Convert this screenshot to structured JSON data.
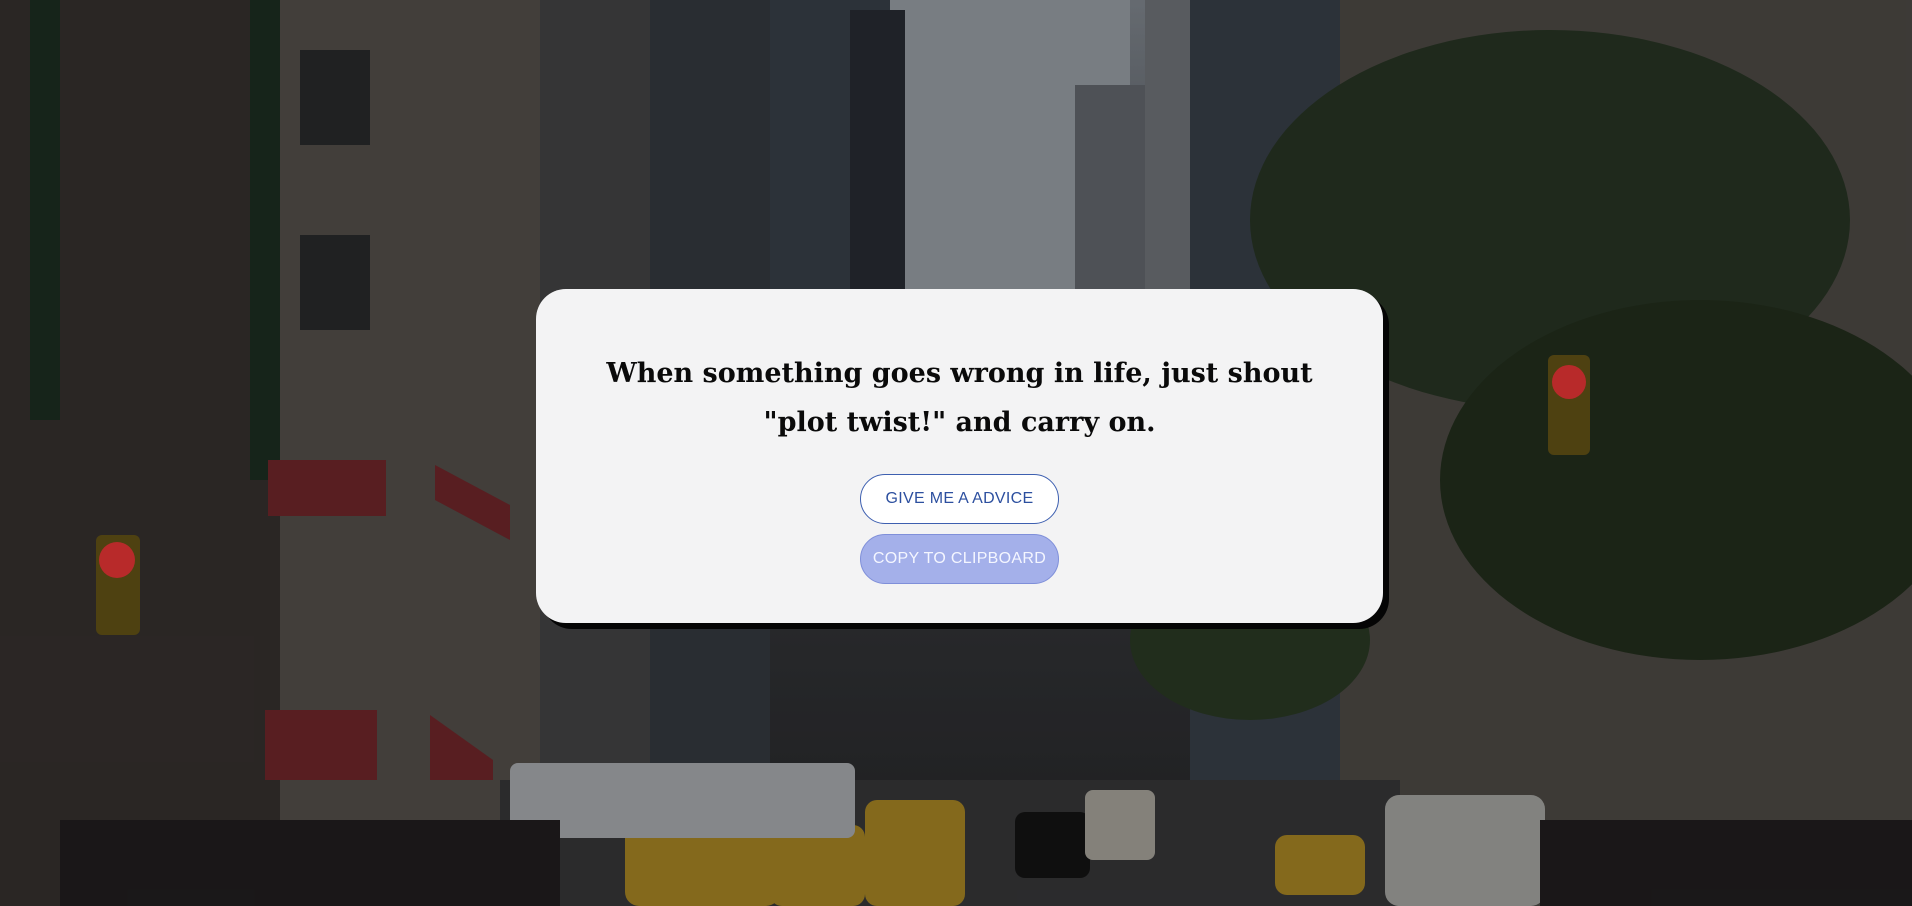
{
  "page": {
    "background_image": "city-street-background"
  },
  "card": {
    "quote": "When something goes wrong in life, just shout \"plot twist!\" and carry on.",
    "advice_button_label": "GIVE ME A ADVICE",
    "copy_button_label": "COPY TO CLIPBOARD"
  },
  "colors": {
    "card_background": "#f3f3f4",
    "advice_button_text": "#2c4f9f",
    "copy_button_background": "#a4b0ea"
  }
}
